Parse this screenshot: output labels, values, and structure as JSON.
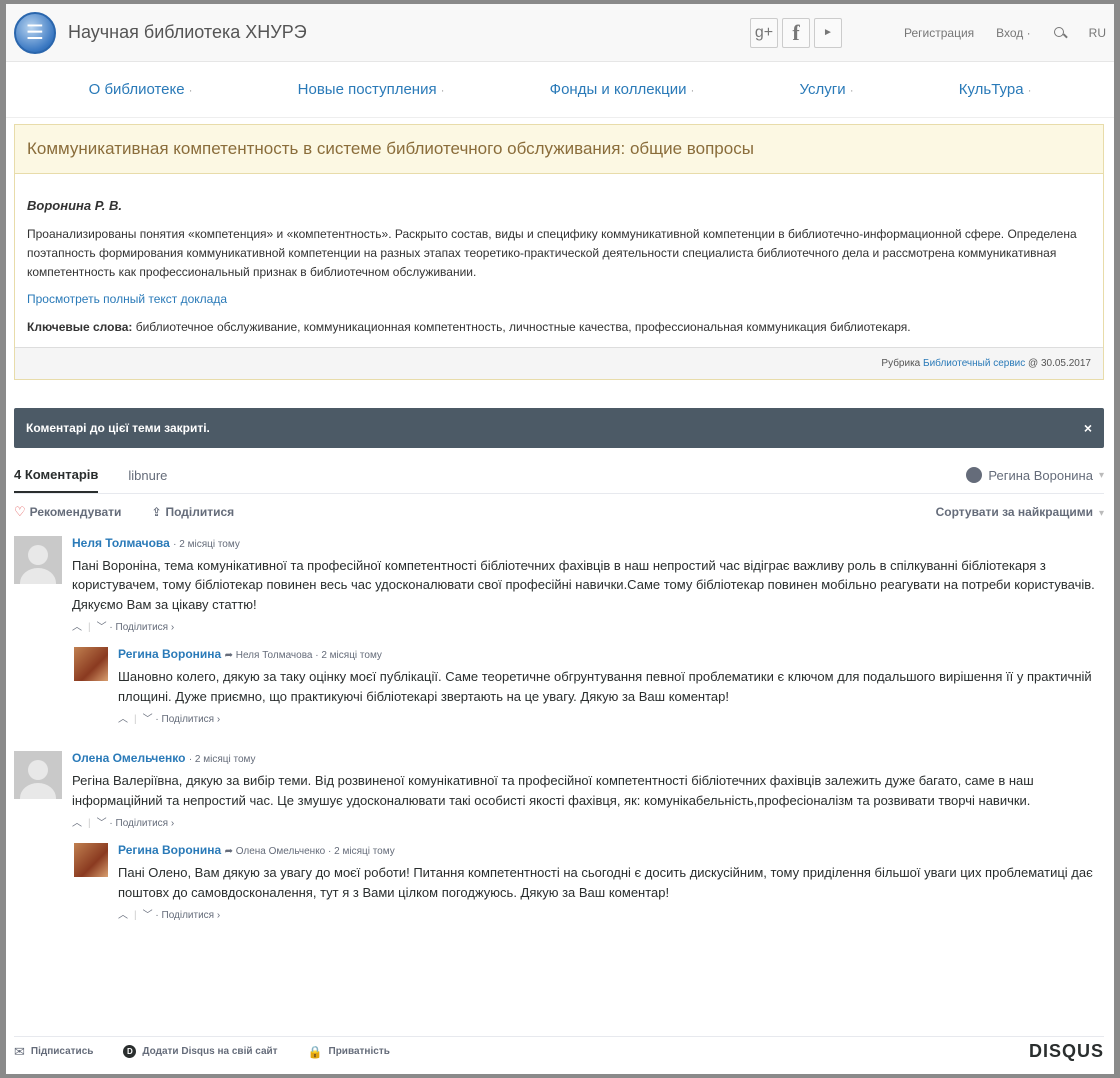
{
  "header": {
    "site_title": "Научная библиотека ХНУРЭ",
    "social": [
      "g+",
      "f",
      "►"
    ],
    "register": "Регистрация",
    "login": "Вход",
    "lang": "RU"
  },
  "nav": [
    "О библиотеке",
    "Новые поступления",
    "Фонды и коллекции",
    "Услуги",
    "КульТура"
  ],
  "article": {
    "title": "Коммуникативная компетентность в системе библиотечного обслуживания: общие вопросы",
    "author": "Воронина Р. В.",
    "abstract": "Проанализированы понятия «компетенция» и «компетентность». Раскрыто состав, виды и специфику коммуникативной компетенции в библиотечно-информационной сфере. Определена поэтапность формирования коммуникативной компетенции на разных этапах теоретико-практической деятельности специалиста библиотечного дела и рассмотрена коммуникативная компетентность как профессиональный признак в библиотечном обслуживании.",
    "fulltext_link": "Просмотреть полный текст доклада",
    "keywords_label": "Ключевые слова:",
    "keywords": "библиотечное обслуживание, коммуникационная компетентность, личностные качества, профессиональная коммуникация библиотекаря.",
    "rubric_label": "Рубрика",
    "rubric": "Библиотечный сервис",
    "date": "@ 30.05.2017"
  },
  "alert": {
    "text": "Коментарі до цієї теми закриті.",
    "close": "×"
  },
  "disqus": {
    "tab_comments": "4 Коментарів",
    "tab_site": "libnure",
    "user": "Регина Воронина",
    "recommend": "Рекомендувати",
    "share": "Поділитися",
    "sort": "Сортувати за найкращими",
    "comments": [
      {
        "name": "Неля Толмачова",
        "meta": "· 2 місяці тому",
        "text": "Пані Вороніна, тема комунікативної та професійної компетентності бібліотечних фахівців в наш непростий час відіграє важливу роль в спілкуванні бібліотекаря з користувачем, тому бібліотекар повинен весь час удосконалювати свої професійні навички.Саме тому бібліотекар повинен мобільно реагувати на потреби користувачів. Дякуємо Вам за цікаву статтю!",
        "share": "Поділитися ›"
      },
      {
        "name": "Регина Воронина",
        "meta": "➦ Неля Толмачова · 2 місяці тому",
        "text": "Шановно колего, дякую за таку оцінку моєї публікації. Саме теоретичне обгрунтування певної проблематики є ключом для подальшого вирішення її у практичній площині. Дуже приємно, що практикуючі бібліотекарі звертають на це увагу. Дякую за Ваш коментар!",
        "share": "Поділитися ›"
      },
      {
        "name": "Олена Омельченко",
        "meta": "· 2 місяці тому",
        "text": "Регіна Валеріївна, дякую за вибір теми. Від розвиненої комунікативної та професійної компетентності бібліотечних фахівців залежить дуже багато, саме в наш інформаційний та непростий час. Це змушує удосконалювати такі особисті якості фахівця, як: комунікабельність,професіоналізм та розвивати творчі навички.",
        "share": "Поділитися ›"
      },
      {
        "name": "Регина Воронина",
        "meta": "➦ Олена Омельченко · 2 місяці тому",
        "text": "Пані Олено, Вам дякую за увагу до моєї роботи! Питання компетентності на сьогодні є досить дискусійним, тому приділення більшої уваги цих проблематиці дає поштовх до самовдосконалення, тут я з Вами цілком погоджуюсь. Дякую за Ваш коментар!",
        "share": "Поділитися ›"
      }
    ],
    "footer": {
      "subscribe": "Підписатись",
      "add_disqus": "Додати Disqus на свій сайт",
      "privacy": "Приватність",
      "logo": "DISQUS"
    }
  }
}
